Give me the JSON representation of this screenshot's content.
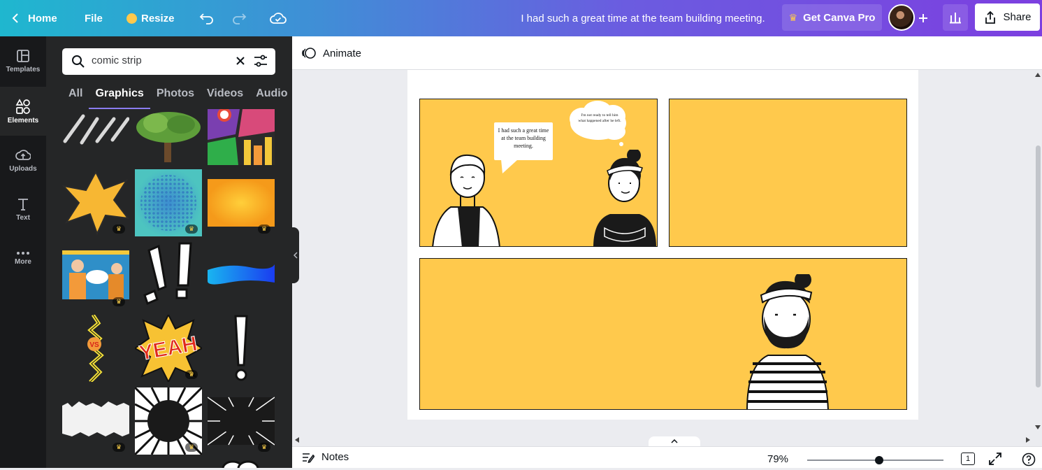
{
  "topbar": {
    "home_label": "Home",
    "file_label": "File",
    "resize_label": "Resize",
    "doc_title": "I had such a great time at the team building meeting.",
    "get_pro_label": "Get Canva Pro",
    "share_label": "Share"
  },
  "rail": {
    "items": [
      {
        "label": "Templates"
      },
      {
        "label": "Elements"
      },
      {
        "label": "Uploads"
      },
      {
        "label": "Text"
      },
      {
        "label": "More"
      }
    ]
  },
  "panel": {
    "search_value": "comic strip",
    "tabs": [
      "All",
      "Graphics",
      "Photos",
      "Videos",
      "Audio"
    ],
    "active_tab": "Graphics"
  },
  "canvas": {
    "animate_label": "Animate",
    "speech_bubble_text": "I had such a great time at the team building meeting.",
    "thought_bubble_text": "I'm not ready to tell him what happened after he left."
  },
  "bottombar": {
    "notes_label": "Notes",
    "zoom_label": "79%",
    "zoom_level_percent": 79,
    "page_count": "1"
  },
  "colors": {
    "accent": "#8b7cf0",
    "panel_yellow": "#ffc94c",
    "sidebar_bg": "#18191b",
    "panel_bg": "#252627"
  }
}
